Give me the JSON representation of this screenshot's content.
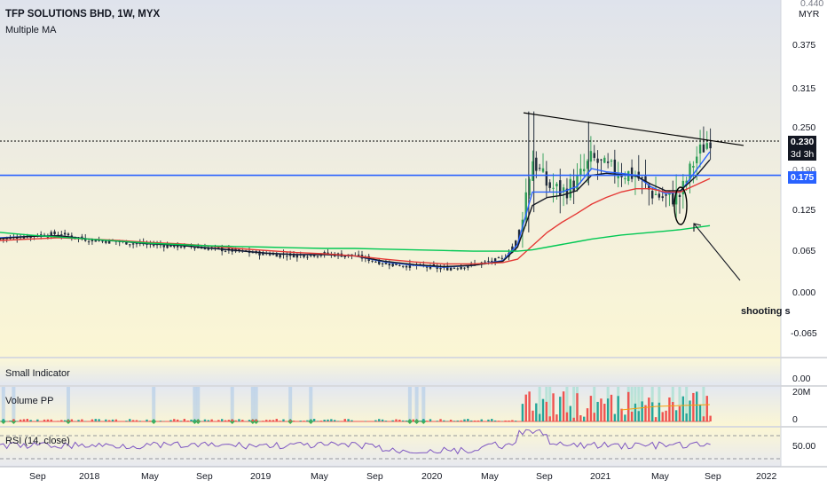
{
  "header": {
    "symbol_line": "TFP SOLUTIONS BHD, 1W, MYX",
    "indicator_line": "Multiple MA"
  },
  "currency": "MYR",
  "price_axis": {
    "ticks": [
      "0.440",
      "0.375",
      "0.315",
      "0.250",
      "0.190",
      "0.125",
      "0.065",
      "0.000",
      "-0.065"
    ],
    "last_price": "0.230",
    "countdown": "3d 3h",
    "hline_price": "0.175"
  },
  "panes": {
    "small_indicator": {
      "label": "Small Indicator",
      "tick": "0.00"
    },
    "volume": {
      "label": "Volume PP",
      "ticks": [
        "20M",
        "0"
      ]
    },
    "rsi": {
      "label": "RSI (14, close)",
      "tick": "50.00"
    }
  },
  "time_axis": [
    "Sep",
    "2018",
    "May",
    "Sep",
    "2019",
    "May",
    "Sep",
    "2020",
    "May",
    "Sep",
    "2021",
    "May",
    "Sep",
    "2022"
  ],
  "annotation": {
    "text": "shooting s"
  },
  "colors": {
    "main_bg_top": "#dfe3ec",
    "main_bg_bottom": "#fbf6d4",
    "candle": "#1f2a3a",
    "candle_up_rally": "#2e9e57",
    "ma_fast_blue": "#2962ff",
    "ma_black": "#131722",
    "ma_red": "#e53935",
    "ma_green": "#00c853",
    "hline_blue": "#2962ff",
    "price_tag_blue": "#2962ff",
    "price_tag_black": "#131722",
    "vol_up": "#26a69a",
    "vol_down": "#ef5350",
    "rsi_line": "#7e57c2"
  },
  "chart_data": {
    "type": "line",
    "title": "TFP SOLUTIONS BHD, 1W, MYX",
    "x": [
      "2017-09",
      "2017-11",
      "2018-01",
      "2018-03",
      "2018-05",
      "2018-07",
      "2018-09",
      "2018-11",
      "2019-01",
      "2019-03",
      "2019-05",
      "2019-07",
      "2019-09",
      "2019-11",
      "2020-01",
      "2020-03",
      "2020-05",
      "2020-07",
      "2020-08",
      "2020-09",
      "2020-10",
      "2020-11",
      "2020-12",
      "2021-01",
      "2021-02",
      "2021-03",
      "2021-04",
      "2021-05",
      "2021-06",
      "2021-07",
      "2021-08",
      "2021-09"
    ],
    "ylim": [
      -0.09,
      0.46
    ],
    "series": [
      {
        "name": "",
        "values": [
          0.08,
          0.085,
          0.088,
          0.079,
          0.076,
          0.072,
          0.07,
          0.067,
          0.062,
          0.058,
          0.056,
          0.058,
          0.055,
          0.044,
          0.04,
          0.036,
          0.042,
          0.05,
          0.08,
          0.2,
          0.16,
          0.15,
          0.165,
          0.2,
          0.185,
          0.18,
          0.175,
          0.15,
          0.14,
          0.145,
          0.2,
          0.23
        ]
      },
      {
        "name": "",
        "values": [
          0.082,
          0.084,
          0.085,
          0.08,
          0.077,
          0.073,
          0.071,
          0.067,
          0.063,
          0.059,
          0.057,
          0.057,
          0.055,
          0.046,
          0.041,
          0.038,
          0.041,
          0.048,
          0.072,
          0.15,
          0.15,
          0.15,
          0.158,
          0.185,
          0.18,
          0.178,
          0.175,
          0.158,
          0.148,
          0.15,
          0.18,
          0.21
        ]
      },
      {
        "name": "",
        "values": [
          0.081,
          0.084,
          0.085,
          0.08,
          0.077,
          0.073,
          0.071,
          0.067,
          0.063,
          0.059,
          0.057,
          0.057,
          0.055,
          0.047,
          0.042,
          0.039,
          0.041,
          0.047,
          0.068,
          0.13,
          0.142,
          0.145,
          0.152,
          0.175,
          0.178,
          0.176,
          0.174,
          0.162,
          0.152,
          0.152,
          0.172,
          0.198
        ]
      },
      {
        "name": "",
        "values": [
          0.078,
          0.08,
          0.082,
          0.08,
          0.078,
          0.075,
          0.073,
          0.07,
          0.066,
          0.063,
          0.06,
          0.058,
          0.055,
          0.05,
          0.046,
          0.043,
          0.043,
          0.045,
          0.05,
          0.07,
          0.09,
          0.105,
          0.118,
          0.132,
          0.142,
          0.15,
          0.155,
          0.155,
          0.15,
          0.15,
          0.16,
          0.17
        ]
      },
      {
        "name": "",
        "values": [
          0.09,
          0.086,
          0.083,
          0.08,
          0.077,
          0.074,
          0.072,
          0.07,
          0.069,
          0.068,
          0.067,
          0.066,
          0.066,
          0.065,
          0.064,
          0.063,
          0.062,
          0.062,
          0.062,
          0.064,
          0.068,
          0.072,
          0.076,
          0.08,
          0.083,
          0.086,
          0.088,
          0.09,
          0.092,
          0.094,
          0.097,
          0.1
        ]
      }
    ],
    "trendline": {
      "from": [
        "2020-09",
        0.268
      ],
      "to": [
        "2021-10",
        0.222
      ]
    },
    "horizontal_line": 0.175
  }
}
